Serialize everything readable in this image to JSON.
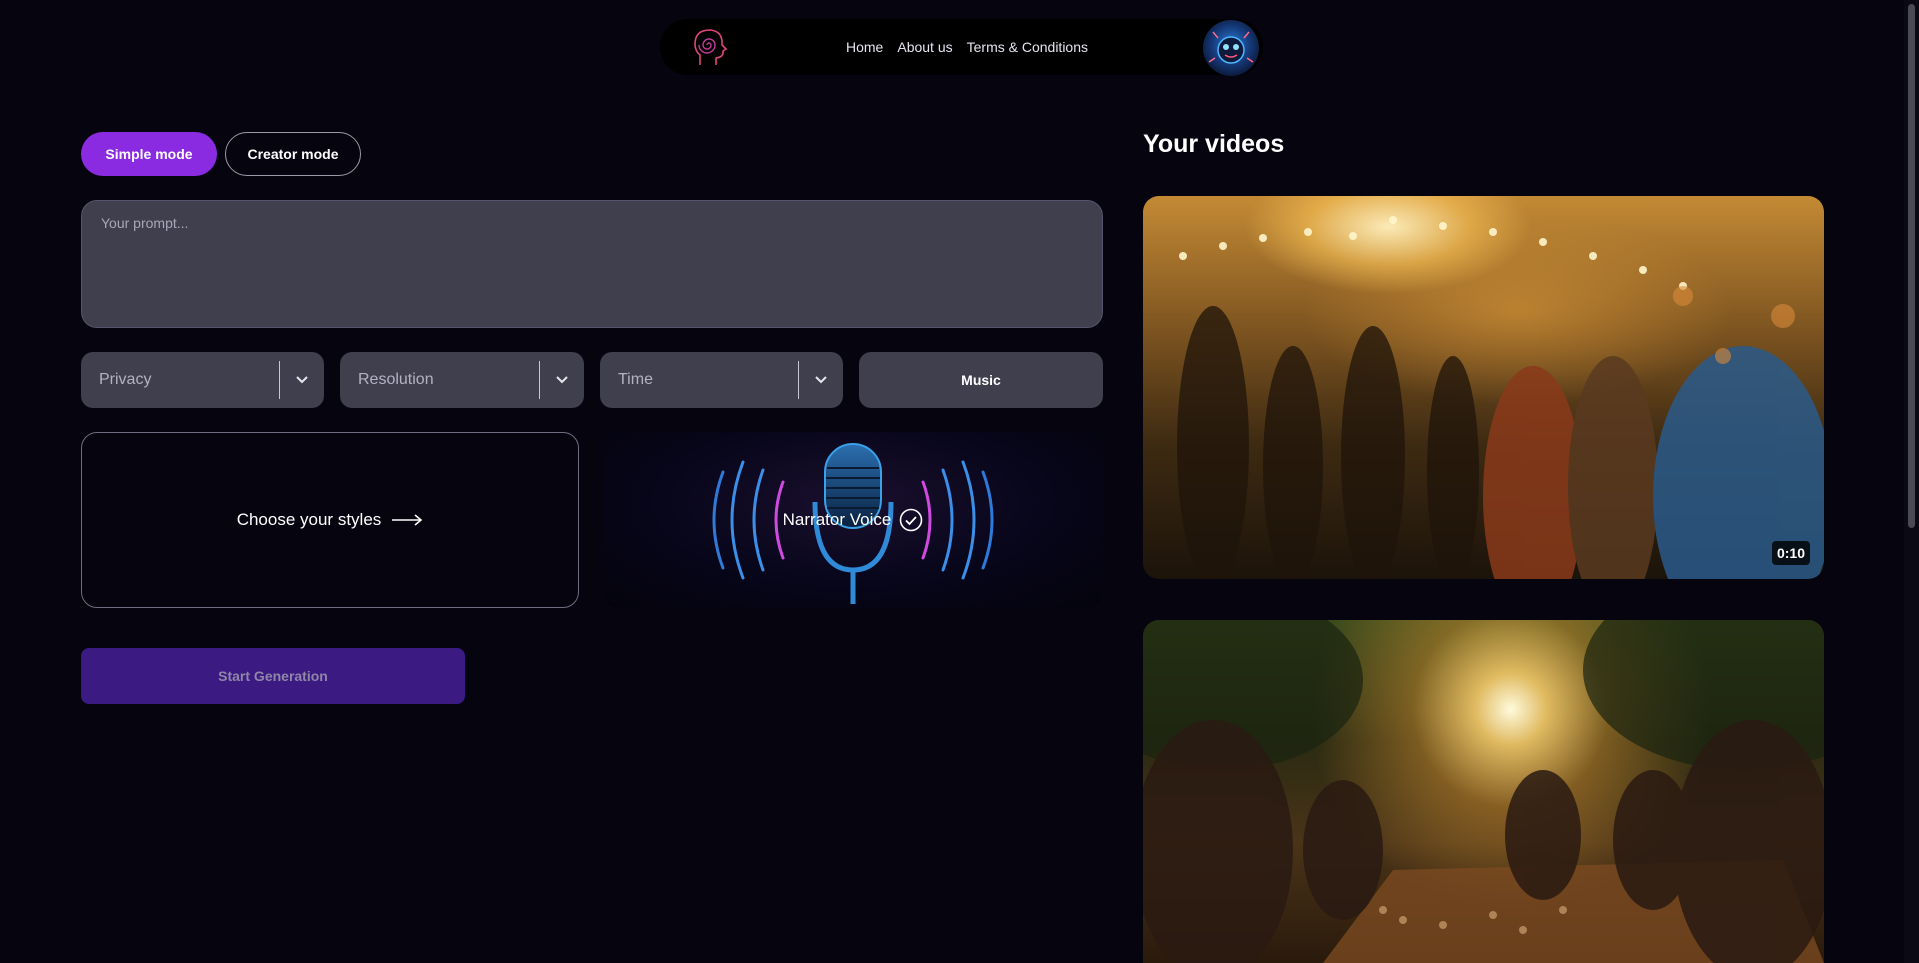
{
  "nav": {
    "links": [
      "Home",
      "About us",
      "Terms & Conditions"
    ]
  },
  "modes": {
    "simple": "Simple mode",
    "creator": "Creator mode",
    "active": "Simple mode"
  },
  "prompt": {
    "placeholder": "Your prompt...",
    "value": ""
  },
  "selects": {
    "privacy": "Privacy",
    "resolution": "Resolution",
    "time": "Time"
  },
  "music": {
    "label": "Music"
  },
  "styles": {
    "label": "Choose your styles",
    "icon": "arrow-right-icon"
  },
  "voice": {
    "label": "Narrator Voice",
    "icon": "check-circle-icon"
  },
  "start": {
    "label": "Start Generation"
  },
  "videos": {
    "title": "Your videos",
    "items": [
      {
        "duration": "0:10"
      },
      {
        "duration": ""
      }
    ]
  },
  "colors": {
    "background": "#05040f",
    "accent": "#8a2be2",
    "field": "#403f4e",
    "start_button": "#3b1a82"
  }
}
